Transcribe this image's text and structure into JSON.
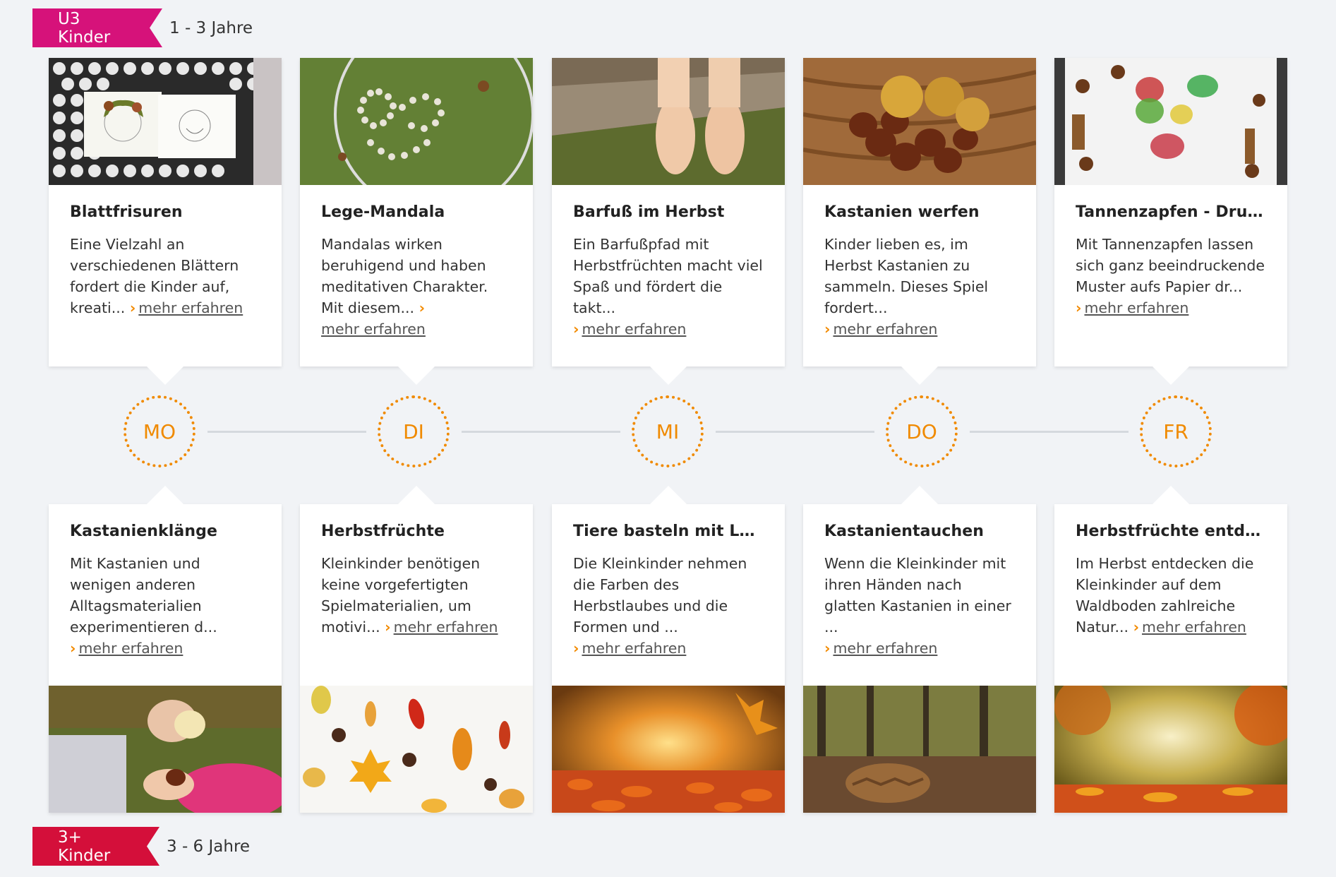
{
  "tags": {
    "top": {
      "label": "U3 Kinder",
      "age": "1 - 3 Jahre",
      "color": "#d6127a"
    },
    "bottom": {
      "label": "3+ Kinder",
      "age": "3 - 6 Jahre",
      "color": "#d40f3a"
    }
  },
  "more_label": "mehr erfahren",
  "days": [
    "MO",
    "DI",
    "MI",
    "DO",
    "FR"
  ],
  "top_cards": [
    {
      "title": "Blattfrisuren",
      "text": "Eine Vielzahl an verschiedenen Blättern fordert die Kinder auf, kreati..."
    },
    {
      "title": "Lege-Mandala",
      "text": "Mandalas wirken beruhigend und haben meditativen Charakter. Mit diesem..."
    },
    {
      "title": "Barfuß im Herbst",
      "text": "Ein Barfußpfad mit Herbstfrüchten macht viel Spaß und fördert die takt..."
    },
    {
      "title": "Kastanien werfen",
      "text": "Kinder lieben es, im Herbst Kastanien zu sammeln. Dieses Spiel fordert..."
    },
    {
      "title": "Tannenzapfen - Druck",
      "text": "Mit Tannenzapfen lassen sich ganz beeindruckende Muster aufs Papier dr..."
    }
  ],
  "bottom_cards": [
    {
      "title": "Kastanienklänge",
      "text": "Mit Kastanien und wenigen anderen Alltagsmaterialien experimentieren d..."
    },
    {
      "title": "Herbstfrüchte",
      "text": "Kleinkinder benötigen keine vorgefertigten Spielmaterialien, um motivi..."
    },
    {
      "title": "Tiere basteln mit Laub",
      "text": "Die Kleinkinder nehmen die Farben des Herbstlaubes und die Formen und ..."
    },
    {
      "title": "Kastanientauchen",
      "text": "Wenn die Kleinkinder mit ihren Händen nach glatten Kastanien in einer ..."
    },
    {
      "title": "Herbstfrüchte entdecken",
      "text": "Im Herbst entdecken die Kleinkinder auf dem Waldboden zahlreiche Natur..."
    }
  ],
  "colors": {
    "accent": "#f08a00",
    "background": "#f1f3f6"
  }
}
